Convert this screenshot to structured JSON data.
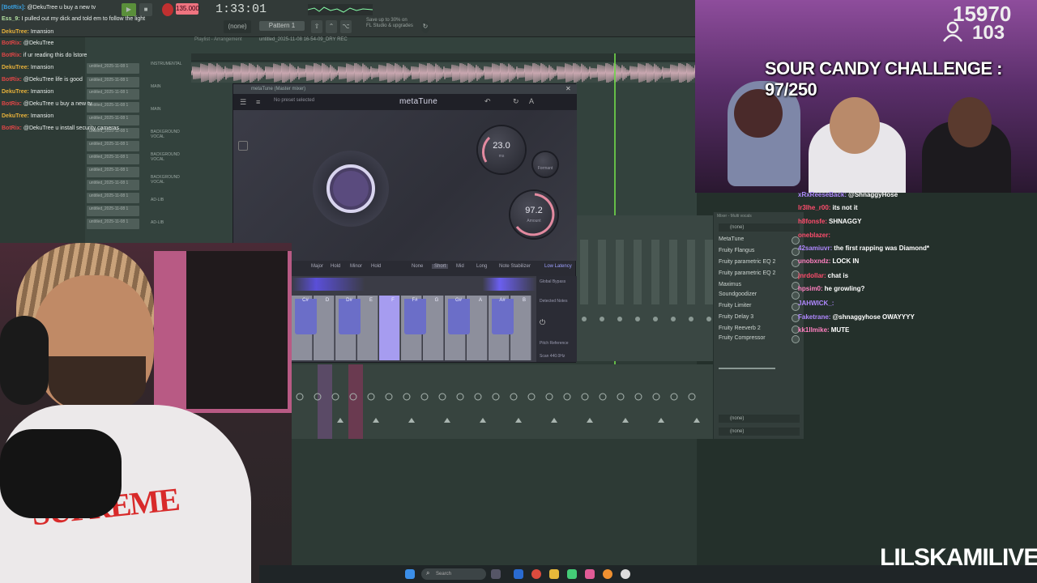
{
  "daw": {
    "tempo": "135.000",
    "time": "1:33:01",
    "pattern": "Pattern 1",
    "none_select": "(none)",
    "hint_line1": "Save up to 30% on",
    "hint_line2": "FL Studio & upgrades",
    "playlist_title": "untitled_2025-11-08 16-54-09_DRY REC",
    "playlist_label": "Playlist - Arrangement",
    "clip_label": "untitled_2025-11-08 1",
    "track_names": [
      "INSTRUMENTAL",
      "MAIN",
      "MAIN",
      "BACKGROUND VOCAL",
      "BACKGROUND VOCAL",
      "BACKGROUND VOCAL",
      "AD-LIB",
      "AD-LIB"
    ]
  },
  "metatune": {
    "window_title": "metaTune (Master mixer)",
    "preset": "No preset selected",
    "logo": "metaTune",
    "speed_value": "23.0",
    "speed_unit": "ms",
    "amount_value": "97.2",
    "amount_label": "Amount",
    "formant_label": "Formant",
    "modes": [
      "Major",
      "Hold",
      "Minor",
      "Hold",
      "None",
      "Short",
      "Mid",
      "Long",
      "Note Stabilizer"
    ],
    "low_latency": "Low Latency",
    "keys": [
      "C#",
      "D",
      "D#",
      "E",
      "F",
      "F#",
      "G",
      "G#",
      "A",
      "A#",
      "B"
    ],
    "side_labels": [
      "Global Bypass",
      "Detected Notes",
      "Pitch Reference",
      "Scan 440.0Hz"
    ]
  },
  "fx": {
    "title": "Mixer - Multi vocals",
    "none": "(none)",
    "slots": [
      "MetaTune",
      "Fruity Flangus",
      "Fruity parametric EQ 2",
      "Fruity parametric EQ 2",
      "Maximus",
      "Soundgoodizer",
      "Fruity Limiter",
      "Fruity Delay 3",
      "Fruity Reeverb 2",
      "Fruity Compressor"
    ],
    "bottom_none": [
      "(none)",
      "(none)"
    ]
  },
  "chat_left": [
    {
      "user": "[BotRix]:",
      "msg": "@DekuTree u buy a new tv",
      "color": "#3aa0e0"
    },
    {
      "user": "Ess_9:",
      "msg": "I pulled out my dick and told em to follow the light",
      "color": "#b3e0a0"
    },
    {
      "user": "DekuTree:",
      "msg": "Imansion",
      "color": "#e7b13a"
    },
    {
      "user": "BotRix:",
      "msg": "@DekuTree",
      "color": "#e04646"
    },
    {
      "user": "BotRix:",
      "msg": "if ur reading this do lstore",
      "color": "#e04646"
    },
    {
      "user": "DekuTree:",
      "msg": "Imansion",
      "color": "#e7b13a"
    },
    {
      "user": "BotRix:",
      "msg": "@DekuTree life is good",
      "color": "#e04646"
    },
    {
      "user": "DekuTree:",
      "msg": "Imansion",
      "color": "#e7b13a"
    },
    {
      "user": "BotRix:",
      "msg": "@DekuTree u buy a new tv",
      "color": "#e04646"
    },
    {
      "user": "DekuTree:",
      "msg": "Imansion",
      "color": "#e7b13a"
    },
    {
      "user": "BotRix:",
      "msg": "@DekuTree u install security cameras",
      "color": "#e04646"
    }
  ],
  "stream": {
    "views": "15970",
    "viewers": "103",
    "challenge": "SOUR CANDY CHALLENGE : 97/250",
    "watermark": "LILSKAMILIVE",
    "search": "Search"
  },
  "chat_right": [
    {
      "user": "xRxReeseBack:",
      "msg": "@ShnaggyHose",
      "color": "#b088ff"
    },
    {
      "user": "lr3lhe_r00:",
      "msg": "its not it",
      "color": "#ff4d6d"
    },
    {
      "user": "h8fonsfe:",
      "msg": "SHNAGGY",
      "color": "#ff4d6d"
    },
    {
      "user": "oneblazer:",
      "msg": "",
      "color": "#ff4d6d"
    },
    {
      "user": "42samiuvr:",
      "msg": "the first rapping was Diamond*",
      "color": "#b088ff"
    },
    {
      "user": "unobxndz:",
      "msg": "LOCK IN",
      "color": "#ff80c0"
    },
    {
      "user": "jnrdollar:",
      "msg": "chat is",
      "color": "#ff4d6d"
    },
    {
      "user": "hpsim0:",
      "msg": "he growling?",
      "color": "#ff80c0"
    },
    {
      "user": "JAHWICK_:",
      "msg": "",
      "color": "#b088ff"
    },
    {
      "user": "Faketrane:",
      "msg": "@shnaggyhose OWAYYYY",
      "color": "#b088ff"
    },
    {
      "user": "kk1llmike:",
      "msg": "MUTE",
      "color": "#ff80c0"
    }
  ],
  "colors": {
    "accent_green": "#6fd24a",
    "tempo_pink": "#ef7480",
    "metatune_purple": "#6b6ec8"
  }
}
